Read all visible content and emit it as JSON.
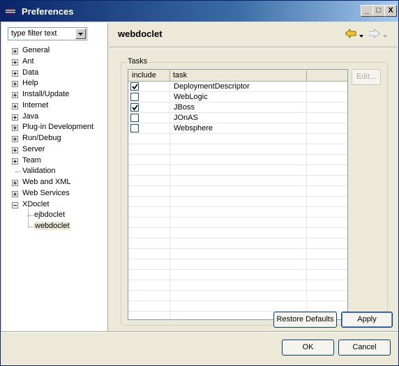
{
  "window": {
    "title": "Preferences",
    "minimize_label": "_",
    "maximize_label": "□",
    "close_label": "X"
  },
  "filter": {
    "text": "type filter text"
  },
  "tree": {
    "items": [
      {
        "label": "General",
        "expander": "plus",
        "level": 0
      },
      {
        "label": "Ant",
        "expander": "plus",
        "level": 0
      },
      {
        "label": "Data",
        "expander": "plus",
        "level": 0
      },
      {
        "label": "Help",
        "expander": "plus",
        "level": 0
      },
      {
        "label": "Install/Update",
        "expander": "plus",
        "level": 0
      },
      {
        "label": "Internet",
        "expander": "plus",
        "level": 0
      },
      {
        "label": "Java",
        "expander": "plus",
        "level": 0
      },
      {
        "label": "Plug-in Development",
        "expander": "plus",
        "level": 0
      },
      {
        "label": "Run/Debug",
        "expander": "plus",
        "level": 0
      },
      {
        "label": "Server",
        "expander": "plus",
        "level": 0
      },
      {
        "label": "Team",
        "expander": "plus",
        "level": 0
      },
      {
        "label": "Validation",
        "expander": "none",
        "level": 0
      },
      {
        "label": "Web and XML",
        "expander": "plus",
        "level": 0
      },
      {
        "label": "Web Services",
        "expander": "plus",
        "level": 0
      },
      {
        "label": "XDoclet",
        "expander": "minus",
        "level": 0
      },
      {
        "label": "ejbdoclet",
        "expander": "none",
        "level": 1
      },
      {
        "label": "webdoclet",
        "expander": "none",
        "level": 1,
        "selected": true
      }
    ]
  },
  "page": {
    "title": "webdoclet",
    "group_label": "Tasks",
    "columns": [
      "include",
      "task"
    ],
    "rows": [
      {
        "include": true,
        "task": "DeploymentDescriptor"
      },
      {
        "include": false,
        "task": "WebLogic"
      },
      {
        "include": true,
        "task": "JBoss"
      },
      {
        "include": false,
        "task": "JOnAS"
      },
      {
        "include": false,
        "task": "Websphere"
      }
    ],
    "edit_label": "Edit...",
    "restore_defaults_label": "Restore Defaults",
    "apply_label": "Apply"
  },
  "dialog": {
    "ok_label": "OK",
    "cancel_label": "Cancel"
  },
  "colors": {
    "title_bar": "#0a246a",
    "selection": "#ece9d8",
    "nav_arrow": "#f0b000"
  },
  "icons": [
    "eclipse-icon",
    "back-arrow-icon",
    "forward-arrow-icon",
    "dropdown-arrow-icon",
    "checkmark-icon"
  ]
}
